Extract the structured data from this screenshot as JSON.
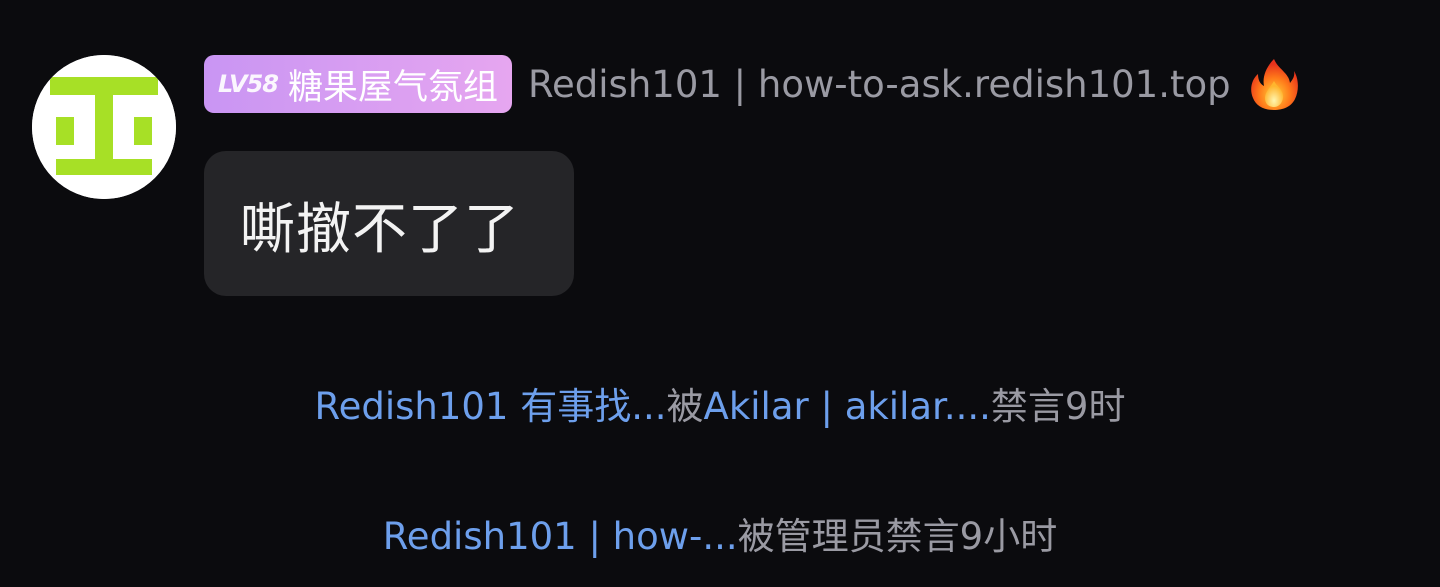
{
  "message": {
    "sender": {
      "level": "LV58",
      "group_title": "糖果屋气氛组",
      "name": "Redish101 | how-to-ask.redish101.top",
      "title_badge_color": "#d79cf2",
      "status_icon": "fire-icon"
    },
    "text": "嘶撤不了了"
  },
  "notices": [
    {
      "target": "Redish101 有事找...",
      "connector": "被",
      "actor": "Akilar | akilar....",
      "action": "禁言9时"
    },
    {
      "target": "Redish101 | how-...",
      "connector": "被管理员禁言9小时"
    }
  ],
  "colors": {
    "background": "#0b0b0e",
    "bubble": "#252528",
    "link": "#6d9fec",
    "muted_text": "#9a9aa3",
    "avatar_green": "#a7e026"
  }
}
